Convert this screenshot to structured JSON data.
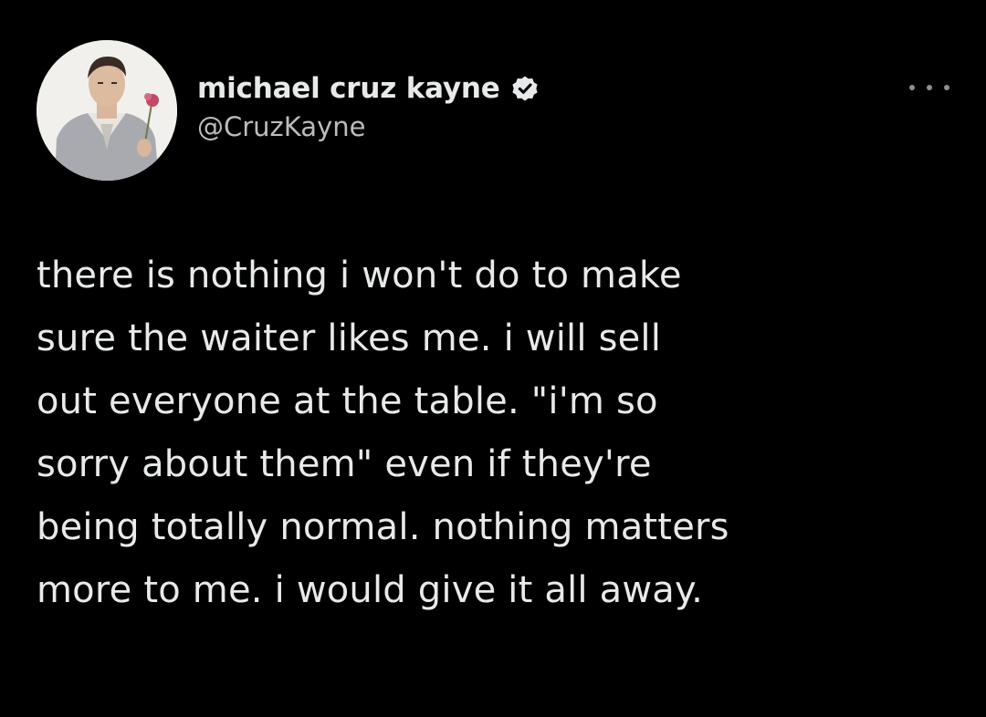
{
  "user": {
    "display_name": "michael cruz kayne",
    "handle": "@CruzKayne",
    "verified": true
  },
  "icons": {
    "verified": "verified-badge-icon",
    "more": "more-options-icon"
  },
  "tweet": {
    "lines": [
      "there is nothing i won't do to make",
      "sure the waiter likes me.  i will sell",
      "out everyone at the table. \"i'm so",
      "sorry about them\" even if they're",
      "being totally normal. nothing matters",
      "more to me. i would give it all away."
    ]
  },
  "colors": {
    "background": "#000000",
    "text": "#e7e9ea",
    "handle": "#b9bcbf",
    "badge": "#e7e9ea"
  }
}
